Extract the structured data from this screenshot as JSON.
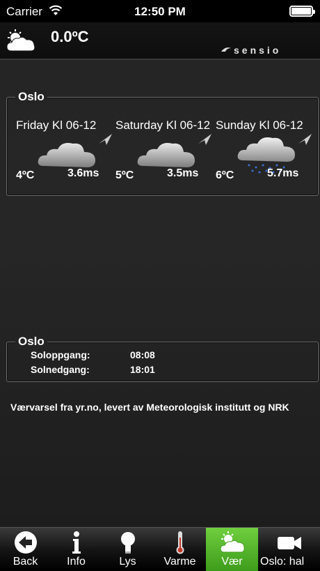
{
  "status_bar": {
    "carrier": "Carrier",
    "time": "12:50 PM"
  },
  "header": {
    "temperature": "0.0ºC",
    "logo_text": "sensio"
  },
  "forecast": {
    "title": "Oslo",
    "days": [
      {
        "label": "Friday Kl 06-12",
        "temp": "4ºC",
        "wind": "3.6ms",
        "icon": "cloudy-icon"
      },
      {
        "label": "Saturday Kl 06-12",
        "temp": "5ºC",
        "wind": "3.5ms",
        "icon": "cloudy-icon"
      },
      {
        "label": "Sunday Kl 06-12",
        "temp": "6ºC",
        "wind": "5.7ms",
        "icon": "rain-icon"
      }
    ]
  },
  "sun": {
    "title": "Oslo",
    "sunrise_label": "Soloppgang:",
    "sunrise": "08:08",
    "sunset_label": "Solnedgang:",
    "sunset": "18:01"
  },
  "credit": "Værvarsel fra yr.no, levert av Meteorologisk institutt og NRK",
  "tabs": [
    {
      "label": "Back",
      "icon": "back-arrow-icon",
      "active": false
    },
    {
      "label": "Info",
      "icon": "info-icon",
      "active": false
    },
    {
      "label": "Lys",
      "icon": "light-bulb-icon",
      "active": false
    },
    {
      "label": "Varme",
      "icon": "thermometer-icon",
      "active": false
    },
    {
      "label": "Vær",
      "icon": "weather-icon",
      "active": true
    },
    {
      "label": "Oslo: hal",
      "icon": "video-camera-icon",
      "active": false
    }
  ],
  "colors": {
    "active_tab": "#56b82c",
    "background": "#1e1e1e"
  }
}
